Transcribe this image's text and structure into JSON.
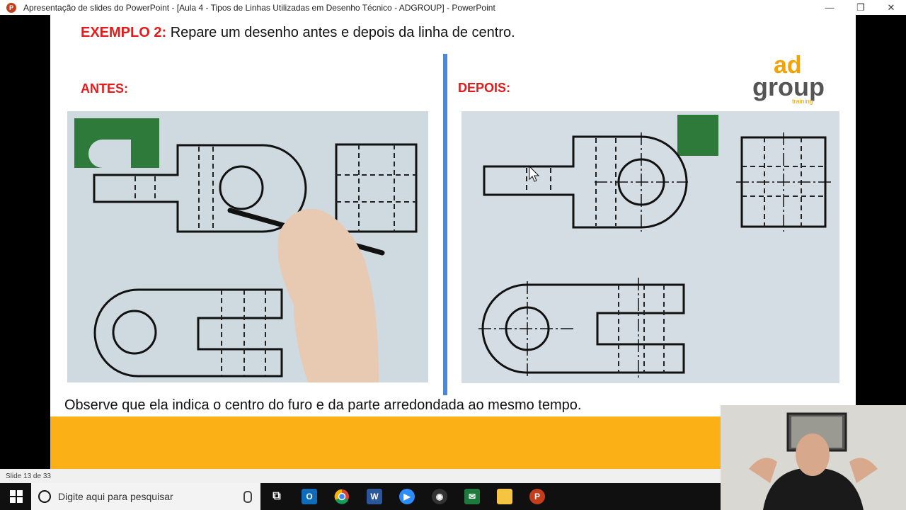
{
  "window": {
    "app_icon_letter": "P",
    "title": "Apresentação de slides do PowerPoint - [Aula 4 - Tipos de Linhas Utilizadas em Desenho Técnico - ADGROUP] - PowerPoint",
    "controls": {
      "minimize": "—",
      "restore": "❐",
      "close": "✕"
    }
  },
  "slide": {
    "heading_prefix": "EXEMPLO 2:",
    "heading_text": " Repare um desenho antes e depois da linha de centro.",
    "before_label": "ANTES:",
    "after_label": "DEPOIS:",
    "caption": "Observe que ela indica o centro do furo e da parte arredondada ao mesmo tempo.",
    "logo": {
      "line1": "ad",
      "line2": "group",
      "line3": "training"
    }
  },
  "status": {
    "slide_counter": "Slide 13 de 33"
  },
  "taskbar": {
    "search_placeholder": "Digite aqui para pesquisar",
    "apps": [
      {
        "name": "task-view",
        "glyph": "⧉"
      },
      {
        "name": "outlook",
        "glyph": "O"
      },
      {
        "name": "chrome",
        "glyph": ""
      },
      {
        "name": "word",
        "glyph": "W"
      },
      {
        "name": "zoom",
        "glyph": "▶"
      },
      {
        "name": "obs",
        "glyph": "◉"
      },
      {
        "name": "excel-like",
        "glyph": "✉"
      },
      {
        "name": "file-explorer",
        "glyph": ""
      },
      {
        "name": "powerpoint",
        "glyph": "P"
      }
    ]
  },
  "colors": {
    "accent_red": "#e31b1b",
    "divider_blue": "#4f87d6",
    "band_orange": "#fbb116",
    "logo_orange": "#f5a300"
  }
}
